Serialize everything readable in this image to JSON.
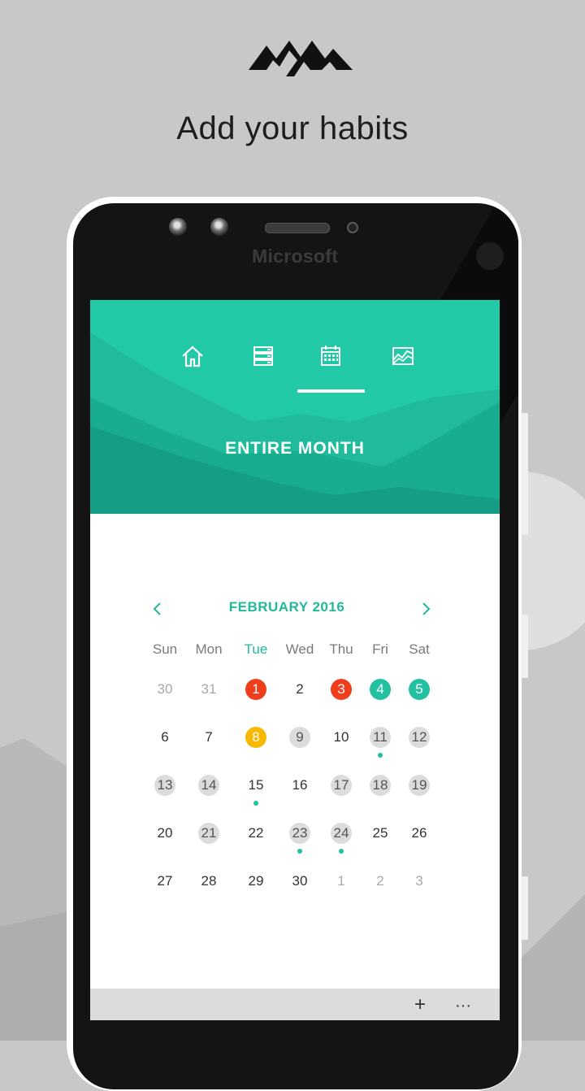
{
  "headline": "Add your habits",
  "device": {
    "brand": "Microsoft"
  },
  "hero": {
    "title": "ENTIRE MONTH"
  },
  "nav": [
    {
      "icon": "home-icon"
    },
    {
      "icon": "list-icon"
    },
    {
      "icon": "calendar-icon",
      "active": true
    },
    {
      "icon": "chart-icon"
    }
  ],
  "calendar": {
    "month_label": "FEBRUARY 2016",
    "weekdays": [
      "Sun",
      "Mon",
      "Tue",
      "Wed",
      "Thu",
      "Fri",
      "Sat"
    ],
    "today_weekday_index": 2,
    "weeks": [
      [
        {
          "d": "30",
          "s": "muted"
        },
        {
          "d": "31",
          "s": "muted"
        },
        {
          "d": "1",
          "s": "red"
        },
        {
          "d": "2",
          "s": ""
        },
        {
          "d": "3",
          "s": "red"
        },
        {
          "d": "4",
          "s": "teal"
        },
        {
          "d": "5",
          "s": "teal"
        }
      ],
      [
        {
          "d": "6",
          "s": ""
        },
        {
          "d": "7",
          "s": ""
        },
        {
          "d": "8",
          "s": "amber"
        },
        {
          "d": "9",
          "s": "grey"
        },
        {
          "d": "10",
          "s": ""
        },
        {
          "d": "11",
          "s": "grey",
          "dot": true
        },
        {
          "d": "12",
          "s": "grey"
        }
      ],
      [
        {
          "d": "13",
          "s": "grey"
        },
        {
          "d": "14",
          "s": "grey"
        },
        {
          "d": "15",
          "s": "",
          "dot": true
        },
        {
          "d": "16",
          "s": ""
        },
        {
          "d": "17",
          "s": "grey"
        },
        {
          "d": "18",
          "s": "grey"
        },
        {
          "d": "19",
          "s": "grey"
        }
      ],
      [
        {
          "d": "20",
          "s": ""
        },
        {
          "d": "21",
          "s": "grey"
        },
        {
          "d": "22",
          "s": ""
        },
        {
          "d": "23",
          "s": "grey",
          "dot": true
        },
        {
          "d": "24",
          "s": "grey",
          "dot": true
        },
        {
          "d": "25",
          "s": ""
        },
        {
          "d": "26",
          "s": ""
        }
      ],
      [
        {
          "d": "27",
          "s": ""
        },
        {
          "d": "28",
          "s": ""
        },
        {
          "d": "29",
          "s": ""
        },
        {
          "d": "30",
          "s": ""
        },
        {
          "d": "1",
          "s": "muted"
        },
        {
          "d": "2",
          "s": "muted"
        },
        {
          "d": "3",
          "s": "muted"
        }
      ]
    ]
  },
  "appbar": {
    "add_label": "+",
    "more_label": "···"
  },
  "colors": {
    "accent": "#22c9a6",
    "red": "#ee3e1c",
    "teal": "#21c1a1",
    "amber": "#f8b800",
    "grey": "#dcdcdc"
  }
}
